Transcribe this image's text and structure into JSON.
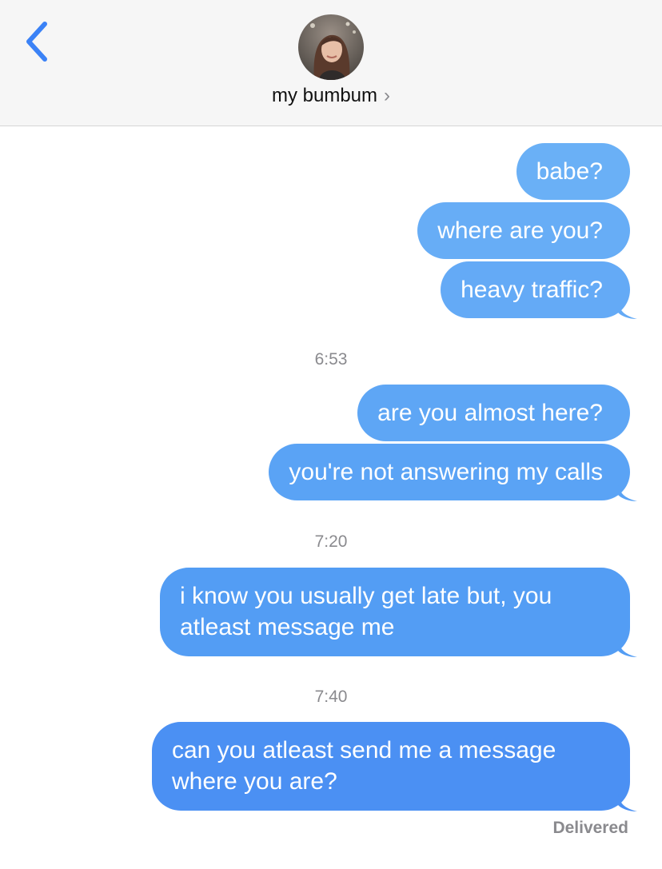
{
  "header": {
    "back_icon": "chevron-left-icon",
    "avatar_icon": "contact-avatar",
    "contact_name": "my bumbum",
    "contact_chevron": "›"
  },
  "colors": {
    "header_bg": "#f6f6f6",
    "accent": "#3b82f6",
    "bubble_top": "#6aaef5",
    "bubble_bottom": "#4a8cf3",
    "meta_text": "#8a8a8e"
  },
  "conversation": {
    "group1": [
      "babe?",
      "where are you?",
      "heavy traffic?"
    ],
    "time2": "6:53",
    "group2": [
      "are you almost here?",
      "you're not answering my calls"
    ],
    "time3": "7:20",
    "group3": [
      "i know you usually get late but, you atleast message me"
    ],
    "time4": "7:40",
    "group4": [
      "can you atleast send me a message where you are?"
    ],
    "status": "Delivered"
  }
}
